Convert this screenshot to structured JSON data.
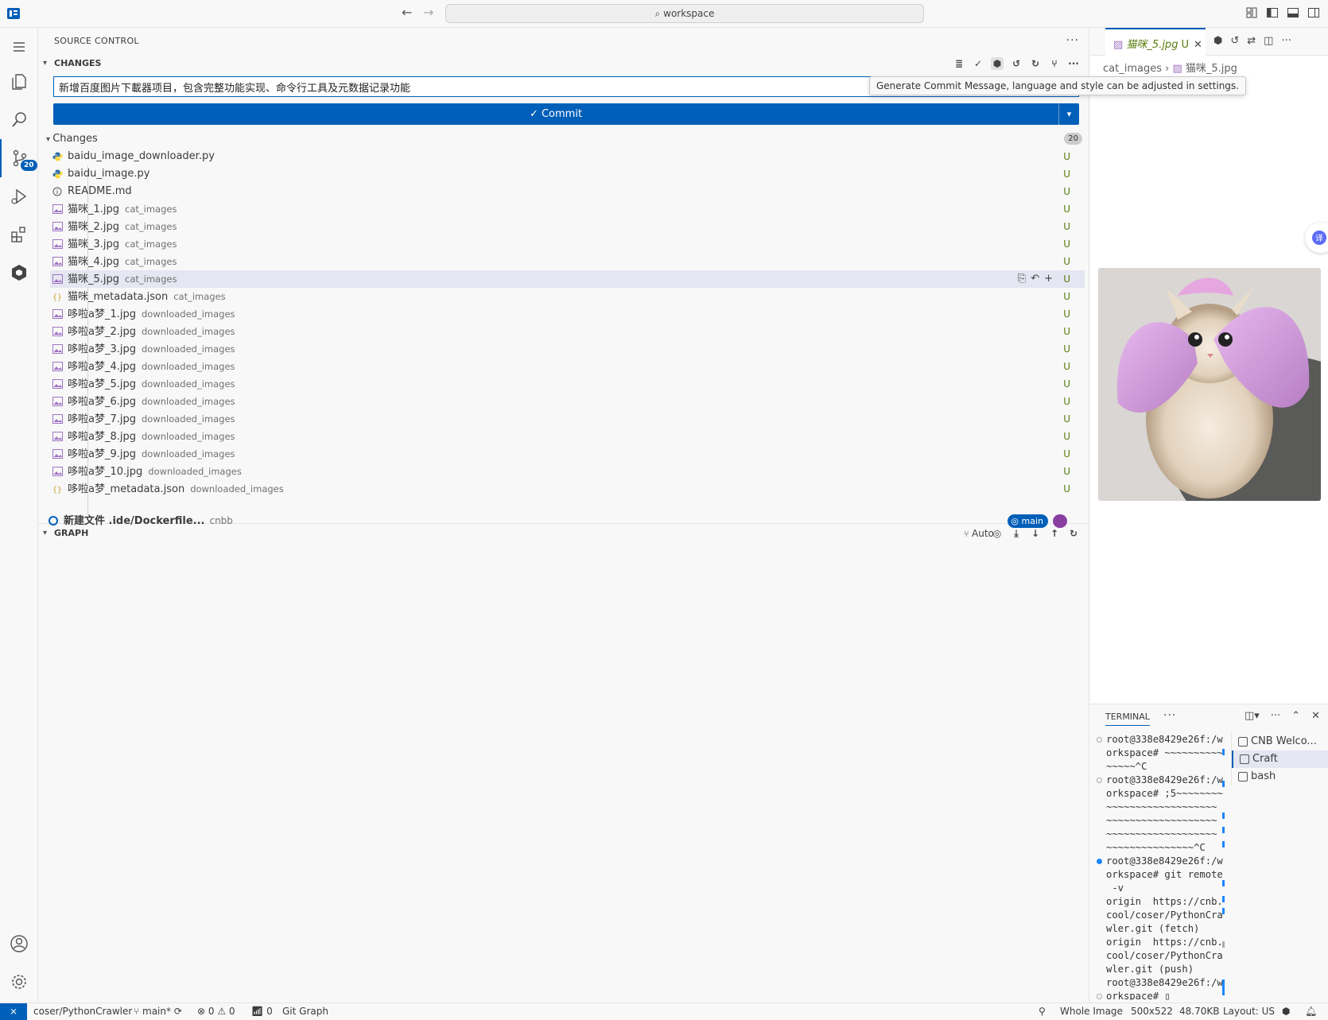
{
  "titlebar": {
    "search": "workspace"
  },
  "activity": {
    "scm_badge": "20"
  },
  "sidebar": {
    "title": "SOURCE CONTROL",
    "changes_section": "CHANGES",
    "commit_message": "新增百度图片下載器项目，包含完整功能实现、命令行工具及元数据记录功能",
    "tooltip": "Generate Commit Message, language and style can be adjusted in settings.",
    "commit_label": "Commit",
    "changes_group": "Changes",
    "changes_count": "20",
    "files": [
      {
        "name": "baidu_image_downloader.py",
        "dir": "",
        "status": "U",
        "type": "py"
      },
      {
        "name": "baidu_image.py",
        "dir": "",
        "status": "U",
        "type": "py"
      },
      {
        "name": "README.md",
        "dir": "",
        "status": "U",
        "type": "md"
      },
      {
        "name": "猫咪_1.jpg",
        "dir": "cat_images",
        "status": "U",
        "type": "img"
      },
      {
        "name": "猫咪_2.jpg",
        "dir": "cat_images",
        "status": "U",
        "type": "img"
      },
      {
        "name": "猫咪_3.jpg",
        "dir": "cat_images",
        "status": "U",
        "type": "img"
      },
      {
        "name": "猫咪_4.jpg",
        "dir": "cat_images",
        "status": "U",
        "type": "img"
      },
      {
        "name": "猫咪_5.jpg",
        "dir": "cat_images",
        "status": "U",
        "type": "img",
        "selected": true
      },
      {
        "name": "猫咪_metadata.json",
        "dir": "cat_images",
        "status": "U",
        "type": "json"
      },
      {
        "name": "哆啦a梦_1.jpg",
        "dir": "downloaded_images",
        "status": "U",
        "type": "img"
      },
      {
        "name": "哆啦a梦_2.jpg",
        "dir": "downloaded_images",
        "status": "U",
        "type": "img"
      },
      {
        "name": "哆啦a梦_3.jpg",
        "dir": "downloaded_images",
        "status": "U",
        "type": "img"
      },
      {
        "name": "哆啦a梦_4.jpg",
        "dir": "downloaded_images",
        "status": "U",
        "type": "img"
      },
      {
        "name": "哆啦a梦_5.jpg",
        "dir": "downloaded_images",
        "status": "U",
        "type": "img"
      },
      {
        "name": "哆啦a梦_6.jpg",
        "dir": "downloaded_images",
        "status": "U",
        "type": "img"
      },
      {
        "name": "哆啦a梦_7.jpg",
        "dir": "downloaded_images",
        "status": "U",
        "type": "img"
      },
      {
        "name": "哆啦a梦_8.jpg",
        "dir": "downloaded_images",
        "status": "U",
        "type": "img"
      },
      {
        "name": "哆啦a梦_9.jpg",
        "dir": "downloaded_images",
        "status": "U",
        "type": "img"
      },
      {
        "name": "哆啦a梦_10.jpg",
        "dir": "downloaded_images",
        "status": "U",
        "type": "img"
      },
      {
        "name": "哆啦a梦_metadata.json",
        "dir": "downloaded_images",
        "status": "U",
        "type": "json"
      }
    ],
    "graph_section": "GRAPH",
    "graph_auto": "Auto",
    "graph_commit": {
      "message": "新建文件 .ide/Dockerfile...",
      "author": "cnbb",
      "branch": "main"
    }
  },
  "editor": {
    "tab_name": "猫咪_5.jpg",
    "tab_status": "U",
    "breadcrumb_dir": "cat_images",
    "breadcrumb_file": "猫咪_5.jpg"
  },
  "panel": {
    "tab": "TERMINAL",
    "terminal_lines": [
      {
        "text": "root@338e8429e26f:/w",
        "dot": "hollow"
      },
      {
        "text": "orkspace# ~~~~~~~~~~",
        "dot": ""
      },
      {
        "text": "~~~~~^C",
        "dot": ""
      },
      {
        "text": "root@338e8429e26f:/w",
        "dot": "hollow"
      },
      {
        "text": "orkspace# ;5~~~~~~~~",
        "dot": ""
      },
      {
        "text": "~~~~~~~~~~~~~~~~~~~",
        "dot": ""
      },
      {
        "text": "~~~~~~~~~~~~~~~~~~~",
        "dot": ""
      },
      {
        "text": "~~~~~~~~~~~~~~~~~~~",
        "dot": ""
      },
      {
        "text": "~~~~~~~~~~~~~~~^C",
        "dot": ""
      },
      {
        "text": "root@338e8429e26f:/w",
        "dot": "blue"
      },
      {
        "text": "orkspace# git remote",
        "dot": ""
      },
      {
        "text": " -v",
        "dot": ""
      },
      {
        "text": "origin  https://cnb.",
        "dot": ""
      },
      {
        "text": "cool/coser/PythonCra",
        "dot": ""
      },
      {
        "text": "wler.git (fetch)",
        "dot": ""
      },
      {
        "text": "origin  https://cnb.",
        "dot": ""
      },
      {
        "text": "cool/coser/PythonCra",
        "dot": ""
      },
      {
        "text": "wler.git (push)",
        "dot": ""
      },
      {
        "text": "root@338e8429e26f:/w",
        "dot": ""
      },
      {
        "text": "orkspace# ▯",
        "dot": "hollow"
      }
    ],
    "terminals": [
      "CNB Welco...",
      "Craft",
      "bash"
    ]
  },
  "statusbar": {
    "repo": "coser/PythonCrawler",
    "branch": "main*",
    "errors": "0",
    "warnings": "0",
    "ports": "0",
    "git_graph": "Git Graph",
    "image_mode": "Whole Image",
    "image_size": "500x522",
    "file_size": "48.70KB",
    "layout": "Layout: US"
  },
  "colors": {
    "accent": "#005fb8",
    "untracked": "#587c0c",
    "selected_row": "#e4e6f1"
  }
}
